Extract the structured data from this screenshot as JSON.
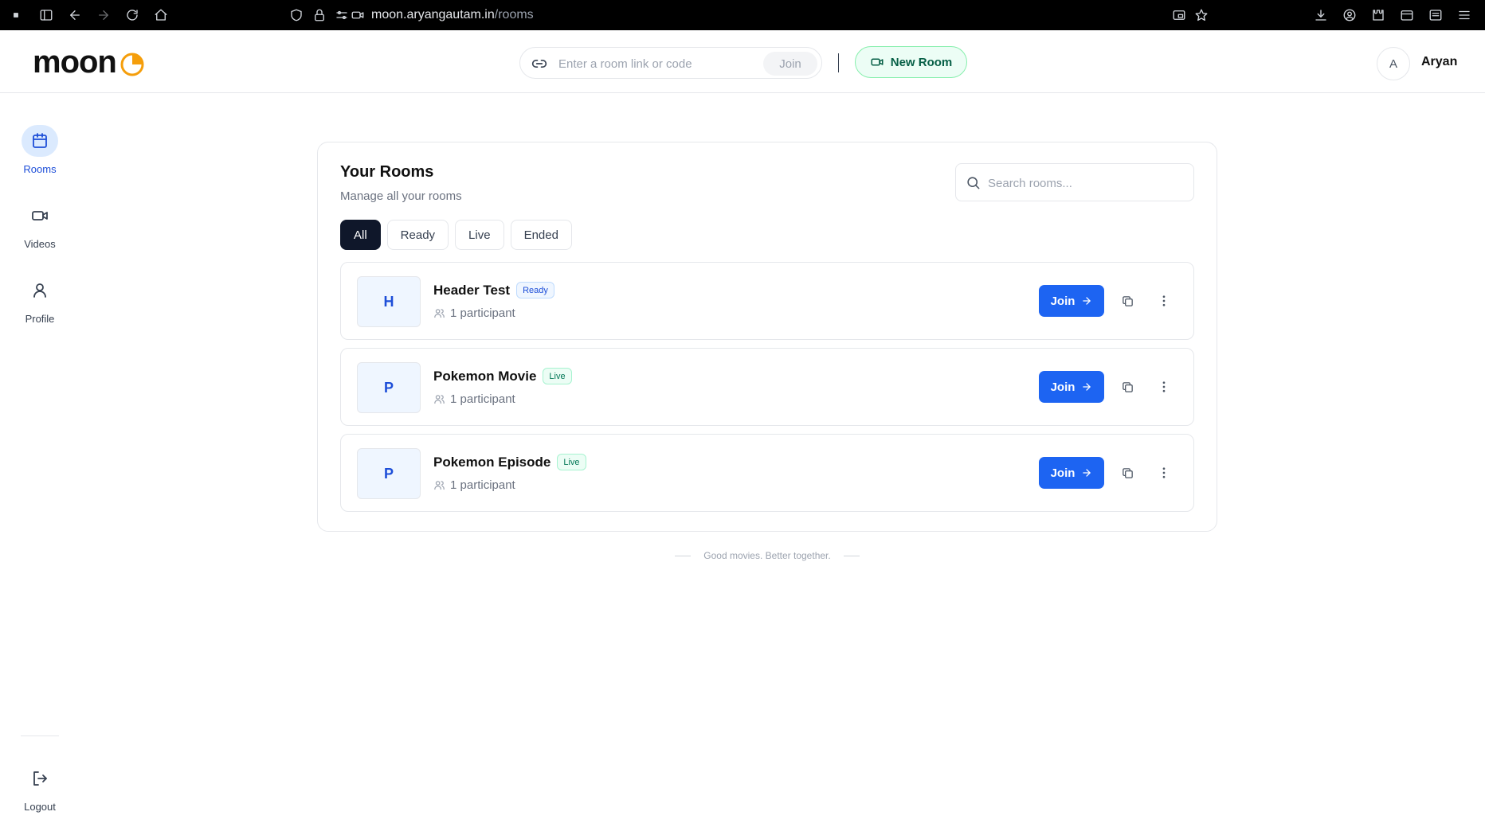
{
  "browser": {
    "url_host": "moon.aryangautam.in",
    "url_path": "/rooms"
  },
  "header": {
    "logo_text": "moon",
    "join_placeholder": "Enter a room link or code",
    "join_label": "Join",
    "new_room_label": "New Room",
    "user_initial": "A",
    "user_name": "Aryan"
  },
  "sidebar": {
    "items": [
      {
        "label": "Rooms",
        "icon": "calendar-icon",
        "active": true
      },
      {
        "label": "Videos",
        "icon": "video-icon",
        "active": false
      },
      {
        "label": "Profile",
        "icon": "user-icon",
        "active": false
      }
    ],
    "logout_label": "Logout"
  },
  "main": {
    "title": "Your Rooms",
    "subtitle": "Manage all your rooms",
    "search_placeholder": "Search rooms...",
    "filters": [
      {
        "label": "All",
        "active": true
      },
      {
        "label": "Ready",
        "active": false
      },
      {
        "label": "Live",
        "active": false
      },
      {
        "label": "Ended",
        "active": false
      }
    ],
    "rooms": [
      {
        "initial": "H",
        "name": "Header Test",
        "status": "Ready",
        "participants": "1 participant",
        "join_label": "Join"
      },
      {
        "initial": "P",
        "name": "Pokemon Movie",
        "status": "Live",
        "participants": "1 participant",
        "join_label": "Join"
      },
      {
        "initial": "P",
        "name": "Pokemon Episode",
        "status": "Live",
        "participants": "1 participant",
        "join_label": "Join"
      }
    ]
  },
  "footer": {
    "tagline": "Good movies. Better together."
  },
  "colors": {
    "accent_blue": "#1d64f2",
    "new_room_bg": "#ecfdf5",
    "logo_orange": "#f59e0b",
    "filter_active": "#0f172a"
  }
}
